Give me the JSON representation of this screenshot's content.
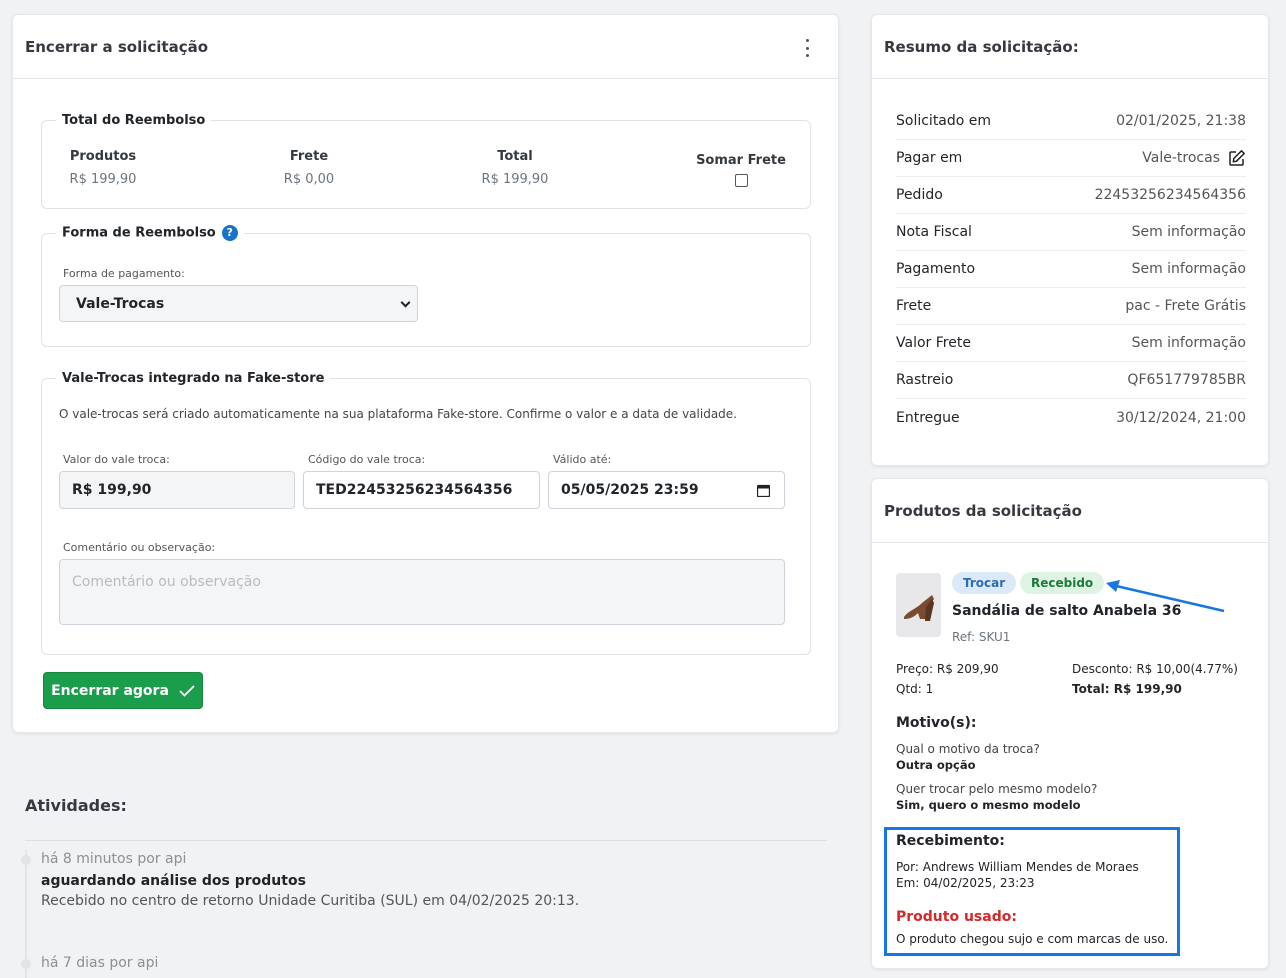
{
  "main": {
    "title": "Encerrar a solicitação",
    "refund_total": {
      "legend": "Total do Reembolso",
      "produtos_label": "Produtos",
      "produtos_value": "R$ 199,90",
      "frete_label": "Frete",
      "frete_value": "R$ 0,00",
      "total_label": "Total",
      "total_value": "R$ 199,90",
      "somar_frete_label": "Somar Frete"
    },
    "refund_method": {
      "legend": "Forma de Reembolso",
      "help": "?",
      "payment_label": "Forma de pagamento:",
      "payment_selected": "Vale-Trocas"
    },
    "voucher": {
      "legend": "Vale-Trocas integrado na Fake-store",
      "description": "O vale-trocas será criado automaticamente na sua plataforma Fake-store. Confirme o valor e a data de validade.",
      "value_label": "Valor do vale troca:",
      "value": "R$ 199,90",
      "code_label": "Código do vale troca:",
      "code": "TED22453256234564356",
      "valid_label": "Válido até:",
      "valid_value": "05/05/2025 23:59",
      "comment_label": "Comentário ou observação:",
      "comment_placeholder": "Comentário ou observação"
    },
    "close_button": "Encerrar agora"
  },
  "activities": {
    "title": "Atividades:",
    "items": [
      {
        "meta": "há 8 minutos por api",
        "title": "aguardando análise dos produtos",
        "desc": "Recebido no centro de retorno Unidade Curitiba (SUL) em 04/02/2025 20:13."
      },
      {
        "meta": "há 7 dias por api"
      }
    ]
  },
  "summary": {
    "title": "Resumo da solicitação:",
    "rows": [
      {
        "k": "Solicitado em",
        "v": "02/01/2025, 21:38"
      },
      {
        "k": "Pagar em",
        "v": "Vale-trocas"
      },
      {
        "k": "Pedido",
        "v": "22453256234564356"
      },
      {
        "k": "Nota Fiscal",
        "v": "Sem informação"
      },
      {
        "k": "Pagamento",
        "v": "Sem informação"
      },
      {
        "k": "Frete",
        "v": "pac - Frete Grátis"
      },
      {
        "k": "Valor Frete",
        "v": "Sem informação"
      },
      {
        "k": "Rastreio",
        "v": "QF651779785BR"
      },
      {
        "k": "Entregue",
        "v": "30/12/2024, 21:00"
      }
    ]
  },
  "products": {
    "title": "Produtos da solicitação",
    "badge_action": "Trocar",
    "badge_status": "Recebido",
    "name": "Sandália de salto Anabela 36",
    "ref": "Ref: SKU1",
    "price": "Preço: R$ 209,90",
    "qty": "Qtd: 1",
    "discount": "Desconto: R$ 10,00(4.77%)",
    "total_label": "Total:",
    "total_value": "R$ 199,90",
    "reasons_title": "Motivo(s):",
    "q1": "Qual o motivo da troca?",
    "a1": "Outra opção",
    "q2": "Quer trocar pelo mesmo modelo?",
    "a2": "Sim, quero o mesmo modelo",
    "receipt_title": "Recebimento:",
    "receipt_by": "Por: Andrews William Mendes de Moraes",
    "receipt_at": "Em: 04/02/2025, 23:23",
    "used_title": "Produto usado:",
    "used_desc": "O produto chegou sujo e com marcas de uso."
  },
  "colors": {
    "primary_green": "#1a9e4b",
    "help_blue": "#1a73c8",
    "highlight_blue": "#1676e3",
    "danger_red": "#d62828"
  }
}
